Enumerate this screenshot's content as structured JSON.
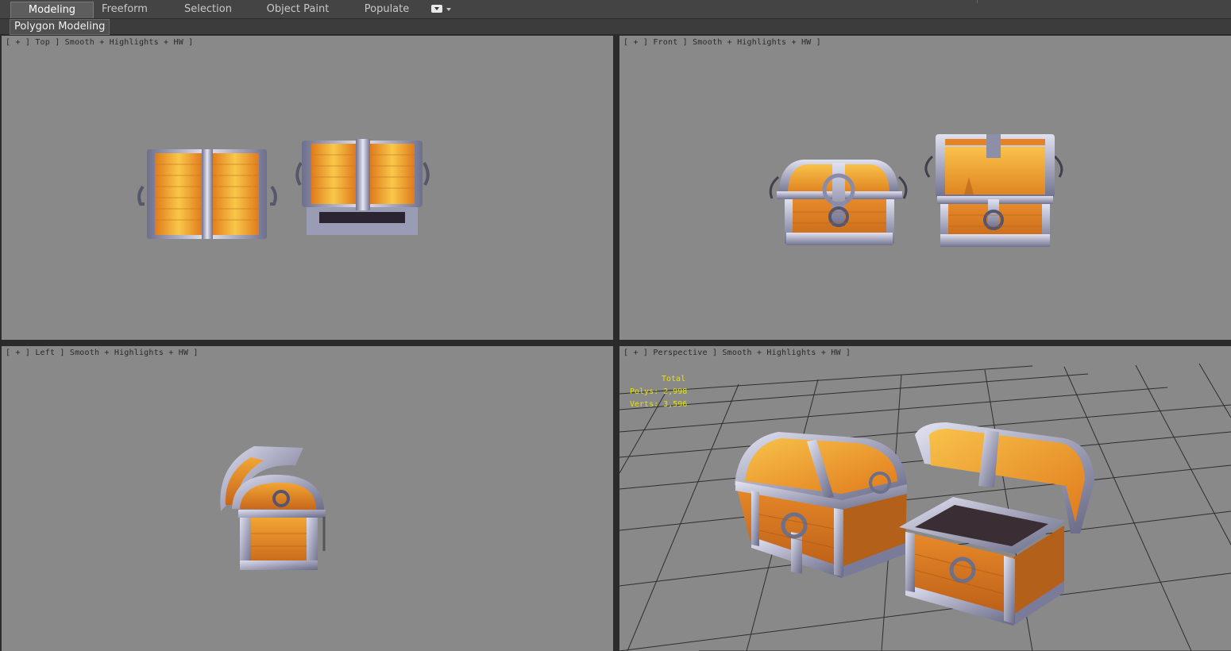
{
  "ribbon": {
    "tabs": [
      {
        "label": "Modeling",
        "active": true
      },
      {
        "label": "Freeform"
      },
      {
        "label": "Selection"
      },
      {
        "label": "Object Paint"
      },
      {
        "label": "Populate"
      }
    ],
    "panel_label": "Polygon Modeling"
  },
  "viewports": {
    "top": {
      "label": "[ + ] Top ] Smooth + Highlights + HW ]"
    },
    "front": {
      "label": "[ + ] Front ] Smooth + Highlights + HW ]"
    },
    "left": {
      "label": "[ + ] Left ] Smooth + Highlights + HW ]"
    },
    "perspective": {
      "label": "[ + ] Perspective ] Smooth + Highlights + HW ]"
    }
  },
  "stats": {
    "title": "Total",
    "polys": "Polys: 2,998",
    "verts": "Verts: 3,596"
  },
  "colors": {
    "viewport_bg": "#898989",
    "wood": "#e8902a",
    "wood_light": "#f7c040",
    "metal": "#a8a9c8",
    "stats_text": "#e6e100"
  }
}
